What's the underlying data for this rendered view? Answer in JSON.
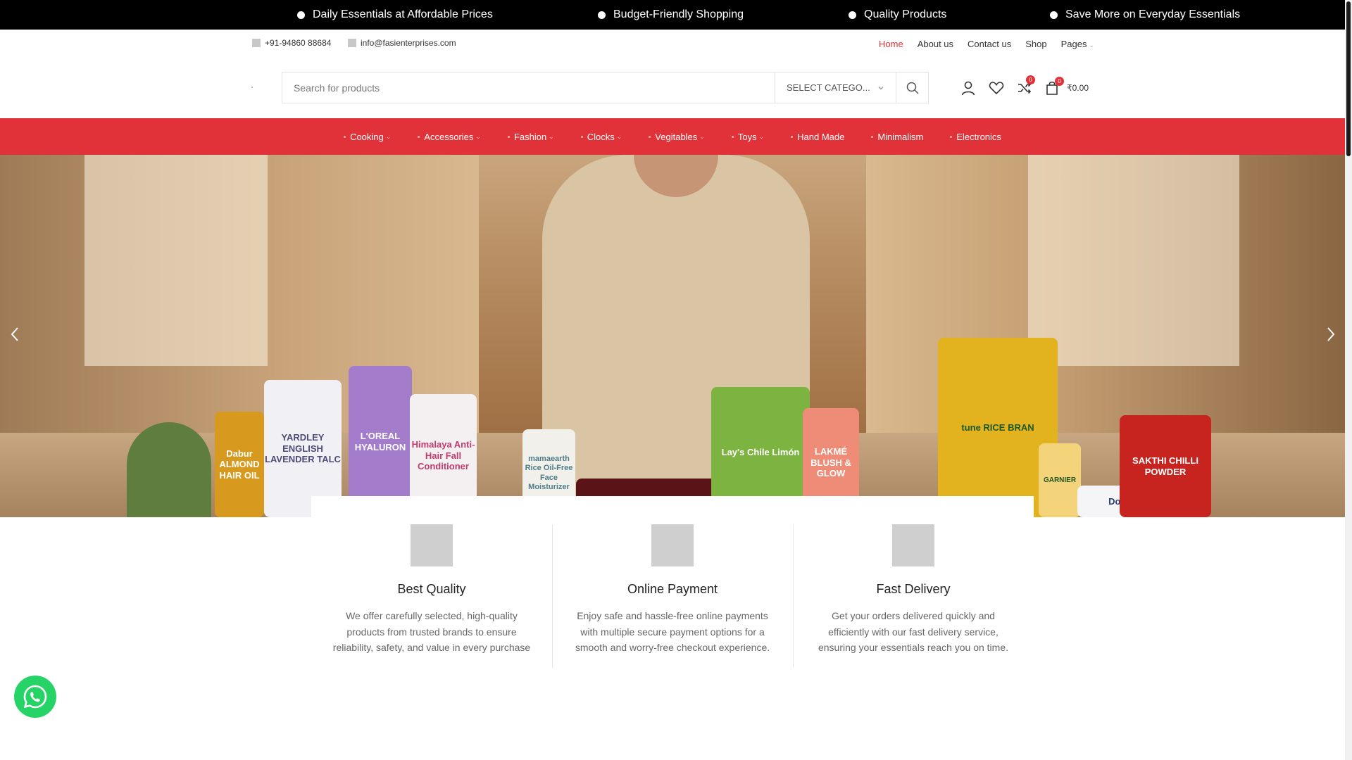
{
  "promo": {
    "items": [
      "Daily Essentials at Affordable Prices",
      "Budget-Friendly Shopping",
      "Quality Products",
      "Save More on Everyday Essentials"
    ]
  },
  "contact": {
    "phone": "+91-94860 88684",
    "email": "info@fasienterprises.com"
  },
  "top_nav": {
    "home": "Home",
    "about": "About us",
    "contact": "Contact us",
    "shop": "Shop",
    "pages": "Pages"
  },
  "search": {
    "placeholder": "Search for products",
    "category": "SELECT CATEGO..."
  },
  "header": {
    "compare_count": "0",
    "cart_count": "0",
    "cart_total": "₹0.00"
  },
  "categories": {
    "cooking": "Cooking",
    "accessories": "Accessories",
    "fashion": "Fashion",
    "clocks": "Clocks",
    "vegitables": "Vegitables",
    "toys": "Toys",
    "hand_made": "Hand Made",
    "minimalism": "Minimalism",
    "electronics": "Electronics"
  },
  "hero": {
    "products": {
      "dabur": "Dabur ALMOND HAIR OIL",
      "yardley": "YARDLEY ENGLISH LAVENDER TALC",
      "loreal": "L'OREAL HYALURON",
      "himalaya": "Himalaya Anti-Hair Fall Conditioner",
      "mamaearth": "mamaearth Rice Oil-Free Face Moisturizer",
      "lays": "Lay's Chile Limón",
      "lakme": "LAKMÉ BLUSH & GLOW",
      "fortune": "tune RICE BRAN",
      "garnier": "GARNIER",
      "dove": "Dove",
      "sakthi": "SAKTHI CHILLI POWDER"
    }
  },
  "features": [
    {
      "title": "Best Quality",
      "text": "We offer carefully selected, high-quality products from trusted brands to ensure reliability, safety, and value in every purchase"
    },
    {
      "title": "Online Payment",
      "text": "Enjoy safe and hassle-free online payments with multiple secure payment options for a smooth and worry-free checkout experience."
    },
    {
      "title": "Fast Delivery",
      "text": "Get your orders delivered quickly and efficiently with our fast delivery service, ensuring your essentials reach you on time."
    }
  ],
  "colors": {
    "accent": "#e03238",
    "promo_bg": "#000000",
    "whatsapp": "#25d366"
  }
}
